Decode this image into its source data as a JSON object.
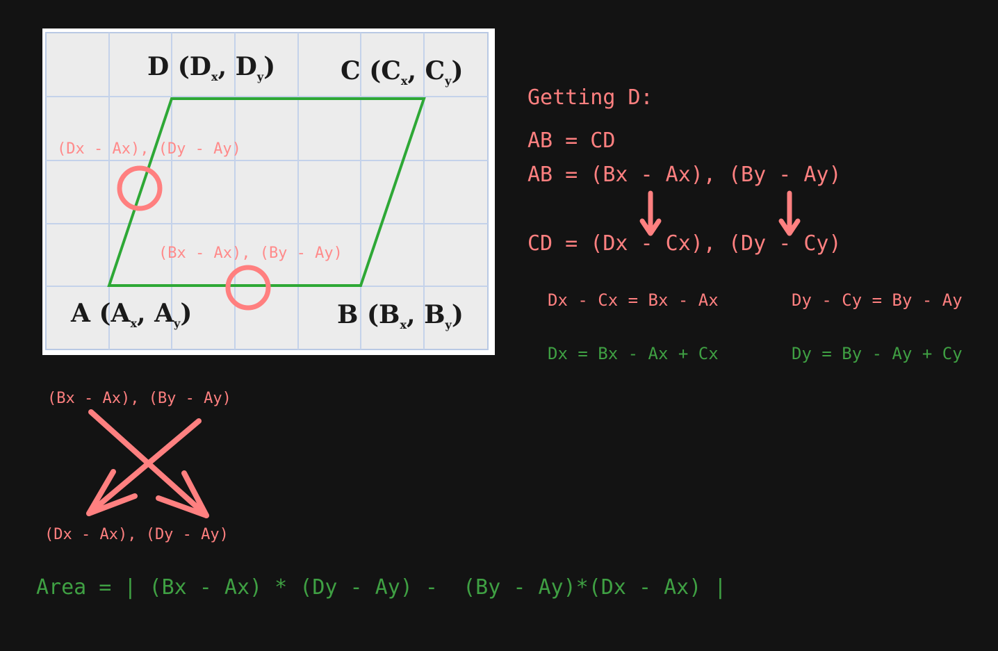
{
  "diagram": {
    "vertex_d": {
      "name": "D",
      "x": "x",
      "y": "y"
    },
    "vertex_c": {
      "name": "C",
      "x": "x",
      "y": "y"
    },
    "vertex_a": {
      "name": "A",
      "x": "x",
      "y": "y"
    },
    "vertex_b": {
      "name": "B",
      "x": "x",
      "y": "y"
    },
    "annotation_ad": "(Dx - Ax), (Dy - Ay)",
    "annotation_ab": "(Bx - Ax), (By - Ay)"
  },
  "derivation": {
    "heading": "Getting D:",
    "line1": "AB = CD",
    "line2": "AB = (Bx - Ax), (By - Ay)",
    "line3": "CD = (Dx - Cx), (Dy - Cy)",
    "eq_x": "Dx - Cx = Bx - Ax",
    "eq_y": "Dy - Cy = By - Ay",
    "res_x": "Dx = Bx - Ax + Cx",
    "res_y": "Dy = By - Ay + Cy"
  },
  "cross": {
    "top": "(Bx - Ax), (By - Ay)",
    "bottom": "(Dx - Ax), (Dy - Ay)"
  },
  "area_formula": "Area = | (Bx - Ax) * (Dy - Ay) -  (By - Ay)*(Dx - Ax) |",
  "colors": {
    "background": "#131313",
    "pink": "#ff8080",
    "green": "#3fa043",
    "grid": "#c4d2ea",
    "shape": "#2ea836"
  }
}
